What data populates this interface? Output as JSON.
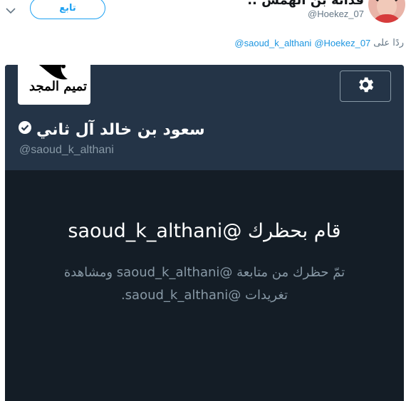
{
  "tweet": {
    "display_name": "فدائه بن الهمس ..",
    "handle": "@Hoekez_07",
    "follow_label": "تابع",
    "reply": {
      "label": "ردًا على",
      "mentions": [
        "@Hoekez_07",
        "@saoud_k_althani"
      ]
    }
  },
  "embedded_profile": {
    "name": "سعود بن خالد آل ثاني",
    "handle": "@saoud_k_althani",
    "logo_text": "تميم المجد",
    "verified": true,
    "blocked_title": "قام بحظرك @saoud_k_althani",
    "blocked_description": "تمّ حظرك من متابعة @saoud_k_althani ومشاهدة تغريدات @saoud_k_althani."
  },
  "colors": {
    "accent": "#1da1f2",
    "card_background": "#141d26",
    "card_header": "#243447",
    "muted_text": "#8899a6"
  },
  "icons": {
    "chevron": "chevron-down-icon",
    "settings": "gear-icon",
    "verified": "verified-badge-icon"
  }
}
